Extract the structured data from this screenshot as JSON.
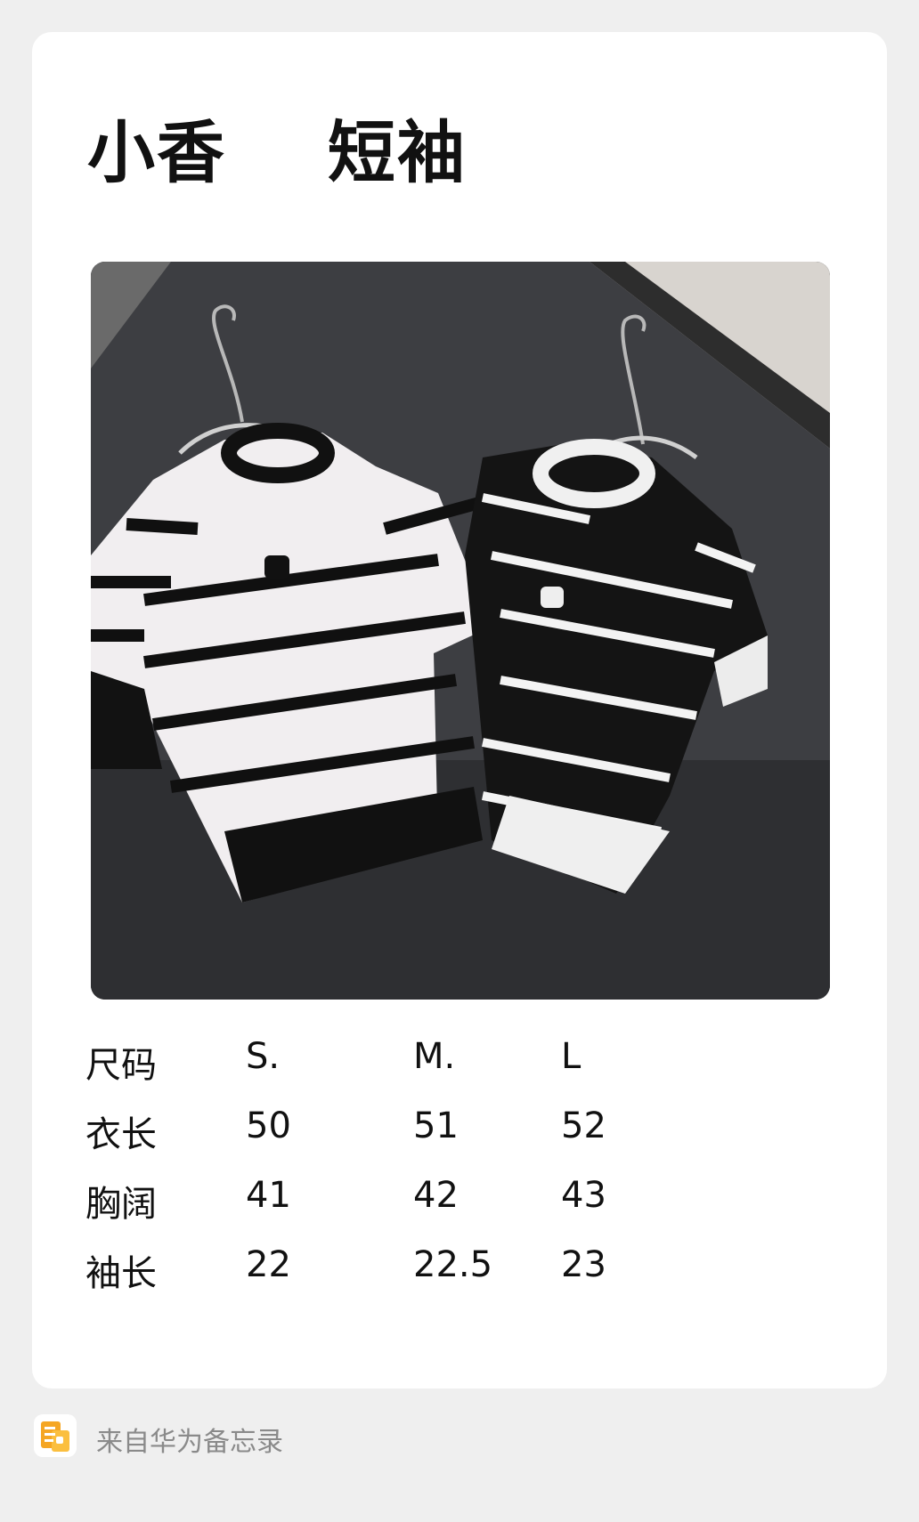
{
  "note": {
    "title": "小香    短袖",
    "photo_alt": "两件针织短袖上衣"
  },
  "size_table": {
    "rows": [
      [
        "尺码",
        " S.",
        " M.",
        " L"
      ],
      [
        "衣长",
        "50",
        "51",
        "52"
      ],
      [
        "胸阔",
        "41",
        "42",
        "43"
      ],
      [
        "袖长",
        "22",
        "22.5",
        "23"
      ]
    ]
  },
  "footer": {
    "source_text": "来自华为备忘录",
    "icon": "memo-app-icon"
  },
  "colors": {
    "background": "#efefef",
    "card": "#ffffff",
    "text": "#111111",
    "muted": "#8a8a8a",
    "icon_accent": "#f5a623"
  }
}
